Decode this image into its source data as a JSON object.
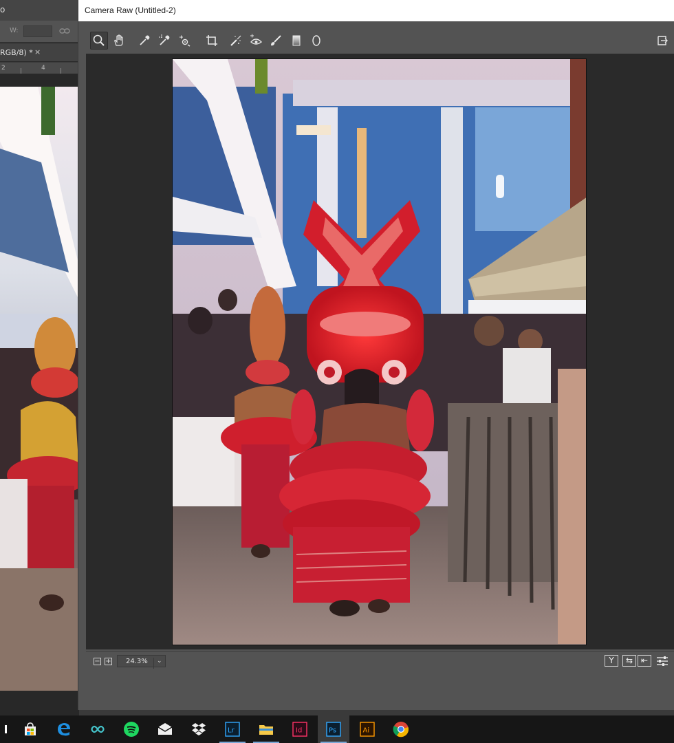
{
  "photoshop": {
    "top_fragment": "o",
    "width_label": "W:",
    "doc_tab_label": "RGB/8) *",
    "doc_tab_close": "×",
    "ruler_marks": [
      "2",
      "4"
    ]
  },
  "camera_raw": {
    "window_title": "Camera Raw (Untitled-2)",
    "toolbar": {
      "tools": [
        "zoom-tool",
        "hand-tool",
        "white-balance-tool",
        "color-sampler-tool",
        "targeted-adjustment-tool",
        "crop-tool",
        "spot-removal-tool",
        "red-eye-removal-tool",
        "adjustment-brush-tool",
        "graduated-filter-tool",
        "radial-filter-tool"
      ],
      "active_tool": "zoom-tool"
    },
    "bottom_bar": {
      "zoom_out_label": "−",
      "zoom_in_label": "+",
      "zoom_value": "24.3%",
      "zoom_dropdown_arrow": "⌄",
      "view_compare_label": "Y",
      "swap_label": "⇆",
      "copy_label": "⇤",
      "settings_icon": "sliders-icon"
    },
    "preview_photo": "Theyyam dancers in red costumes inside temple"
  },
  "taskbar": {
    "apps": [
      {
        "name": "store",
        "label": ""
      },
      {
        "name": "edge",
        "label": ""
      },
      {
        "name": "infinity",
        "label": ""
      },
      {
        "name": "spotify",
        "label": ""
      },
      {
        "name": "mail",
        "label": ""
      },
      {
        "name": "dropbox",
        "label": ""
      },
      {
        "name": "lightroom",
        "label": "Lr"
      },
      {
        "name": "file-explorer",
        "label": ""
      },
      {
        "name": "indesign",
        "label": "Id"
      },
      {
        "name": "photoshop",
        "label": "Ps"
      },
      {
        "name": "illustrator",
        "label": "Ai"
      },
      {
        "name": "chrome",
        "label": ""
      }
    ]
  },
  "colors": {
    "accent_underline": "#7aa7d6",
    "lightroom": "#31a8ff",
    "indesign": "#ff3366",
    "photoshop": "#31a8ff",
    "illustrator": "#ff9a00",
    "spotify": "#1ed760"
  }
}
